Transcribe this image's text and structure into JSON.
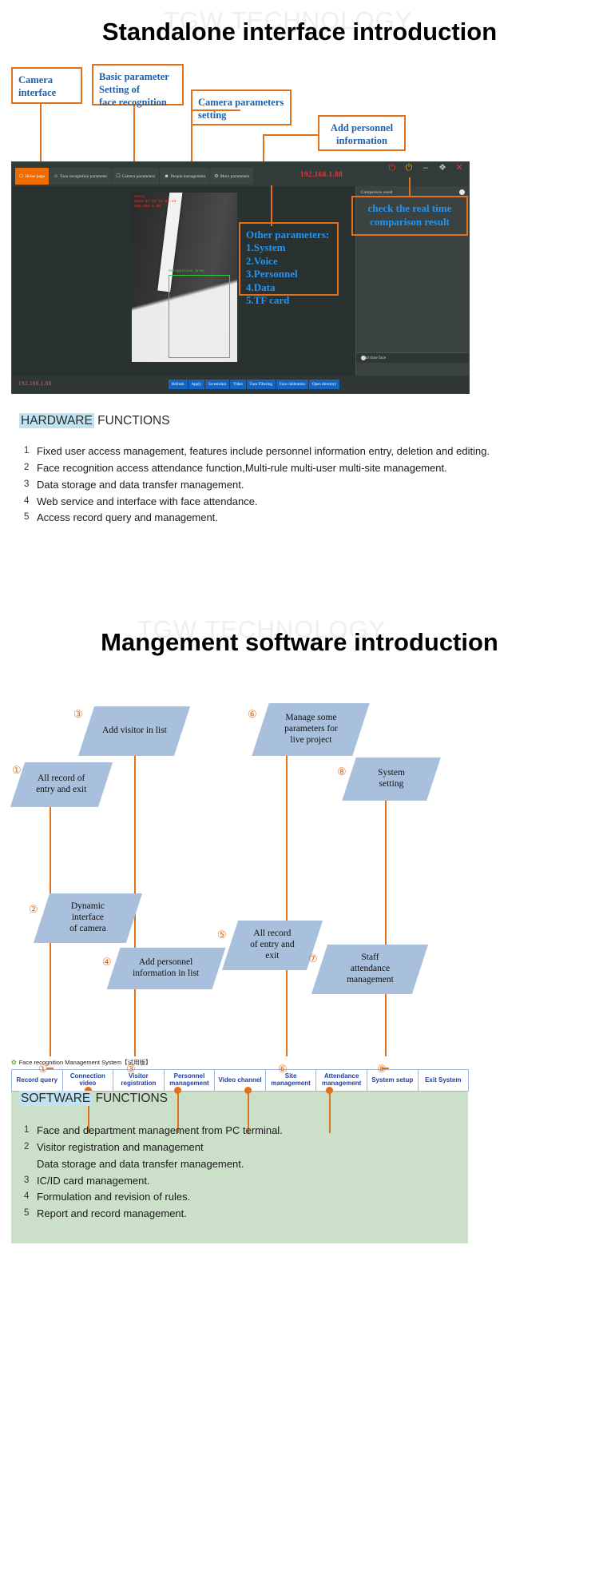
{
  "watermark": "TGW TECHNOLOGY",
  "section1": {
    "title": "Standalone interface introduction",
    "callouts": [
      {
        "id": "camera-interface",
        "lines": [
          "Camera",
          "interface"
        ]
      },
      {
        "id": "basic-parameter",
        "lines": [
          "Basic parameter",
          "Setting of",
          "face recognition"
        ]
      },
      {
        "id": "camera-parameters",
        "lines": [
          "Camera parameters",
          "setting"
        ]
      },
      {
        "id": "add-personnel",
        "lines": [
          "Add personnel",
          "information"
        ]
      },
      {
        "id": "other-parameters",
        "lines": [
          "Other parameters:",
          "1.System",
          "2.Voice",
          "3.Personnel",
          "4.Data",
          "5.TF card"
        ]
      },
      {
        "id": "comparison-result",
        "lines": [
          "check the real time",
          "comparison result"
        ]
      }
    ],
    "app": {
      "tabs": [
        {
          "label": "Home page",
          "icon": "home-icon",
          "active": true
        },
        {
          "label": "Face recognition parameter",
          "icon": "face-icon",
          "active": false
        },
        {
          "label": "Camera parameters",
          "icon": "camera-icon",
          "active": false
        },
        {
          "label": "People management",
          "icon": "people-icon",
          "active": false
        },
        {
          "label": "More parameters",
          "icon": "gear-icon",
          "active": false
        }
      ],
      "ip_top": "192.168.1.88",
      "ip_bottom": "192.168.1.88",
      "window_controls": [
        "power-icon",
        "standby-icon",
        "minimize-icon",
        "maximize-icon",
        "close-icon"
      ],
      "right_panel_title": "Comparison result",
      "right_panel_footer": "Real time face",
      "osd": {
        "line1": "entry",
        "line2": "2019-07-03 11:08:43",
        "line3": "192.168.1.88",
        "detect_label": "Recognition area"
      },
      "bottom_buttons": [
        "Refresh",
        "Apply",
        "Screenshot",
        "Video",
        "Face Filtering",
        "Face calibration",
        "Open directory"
      ]
    }
  },
  "hardware": {
    "heading_highlight": "HARDWARE",
    "heading_rest": " FUNCTIONS",
    "items": [
      {
        "n": "1",
        "text": "Fixed user access management, features include personnel information entry, deletion and editing."
      },
      {
        "n": "2",
        "text": "Face recognition access attendance function,Multi-rule multi-user multi-site management."
      },
      {
        "n": "3",
        "text": "Data storage and data transfer management."
      },
      {
        "n": "4",
        "text": "Web service and interface with face attendance."
      },
      {
        "n": "5",
        "text": "Access record query and management."
      }
    ]
  },
  "section2": {
    "title": "Mangement software introduction",
    "app_title": "Face recognition Management System【试用版】",
    "menu_buttons": [
      "Record query",
      "Connection video",
      "Visitor registration",
      "Personnel management",
      "Video channel",
      "Site management",
      "Attendance management",
      "System setup",
      "Exit System"
    ],
    "callouts": [
      {
        "num": "①",
        "lines": [
          "All record of",
          "entry and exit"
        ]
      },
      {
        "num": "②",
        "lines": [
          "Dynamic",
          "interface",
          "of camera"
        ]
      },
      {
        "num": "③",
        "lines": [
          "Add visitor in list"
        ]
      },
      {
        "num": "④",
        "lines": [
          "Add personnel",
          "information in list"
        ]
      },
      {
        "num": "⑤",
        "lines": [
          "All record",
          "of entry and",
          "exit"
        ]
      },
      {
        "num": "⑥",
        "lines": [
          "Manage some",
          "parameters for",
          "live project"
        ]
      },
      {
        "num": "⑦",
        "lines": [
          "Staff",
          "attendance",
          "management"
        ]
      },
      {
        "num": "⑧",
        "lines": [
          "System",
          "setting"
        ]
      }
    ]
  },
  "software": {
    "heading_highlight": "SOFTWARE",
    "heading_rest": " FUNCTIONS",
    "items": [
      {
        "n": "1",
        "text": "Face and department management from PC terminal."
      },
      {
        "n": "2",
        "text": "Visitor registration and management",
        "sub": "Data storage and data transfer management."
      },
      {
        "n": "3",
        "text": "IC/ID card management."
      },
      {
        "n": "4",
        "text": "Formulation and revision of rules."
      },
      {
        "n": "5",
        "text": "Report and record management."
      }
    ]
  },
  "colors": {
    "accent_orange": "#e2711d",
    "callout_blue": "#1f5fa8",
    "highlight_cyan": "#bfe3f2",
    "menu_blue": "#1f3f9e",
    "para_blue": "#a8c0dc",
    "canvas_green": "#ccdfc8"
  }
}
